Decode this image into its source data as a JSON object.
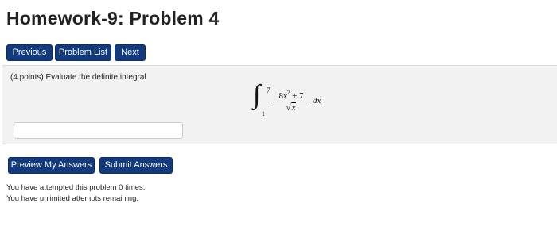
{
  "page": {
    "title": "Homework-9: Problem 4"
  },
  "nav": {
    "previous_label": "Previous",
    "problem_list_label": "Problem List",
    "next_label": "Next"
  },
  "problem": {
    "prompt": "(4 points) Evaluate the definite integral",
    "integral": {
      "lower_limit": "1",
      "upper_limit": "7",
      "numerator_coef": "8",
      "numerator_var": "x",
      "numerator_exp": "2",
      "numerator_rest": " + 7",
      "denominator_radical": "√",
      "denominator_var": "x",
      "differential": "dx"
    }
  },
  "answer": {
    "value": "",
    "placeholder": ""
  },
  "actions": {
    "preview_label": "Preview My Answers",
    "submit_label": "Submit Answers"
  },
  "status": {
    "attempts_text": "You have attempted this problem 0 times.",
    "remaining_text": "You have unlimited attempts remaining."
  },
  "colors": {
    "button_bg": "#123a7f",
    "panel_bg": "#f2f2f2"
  }
}
